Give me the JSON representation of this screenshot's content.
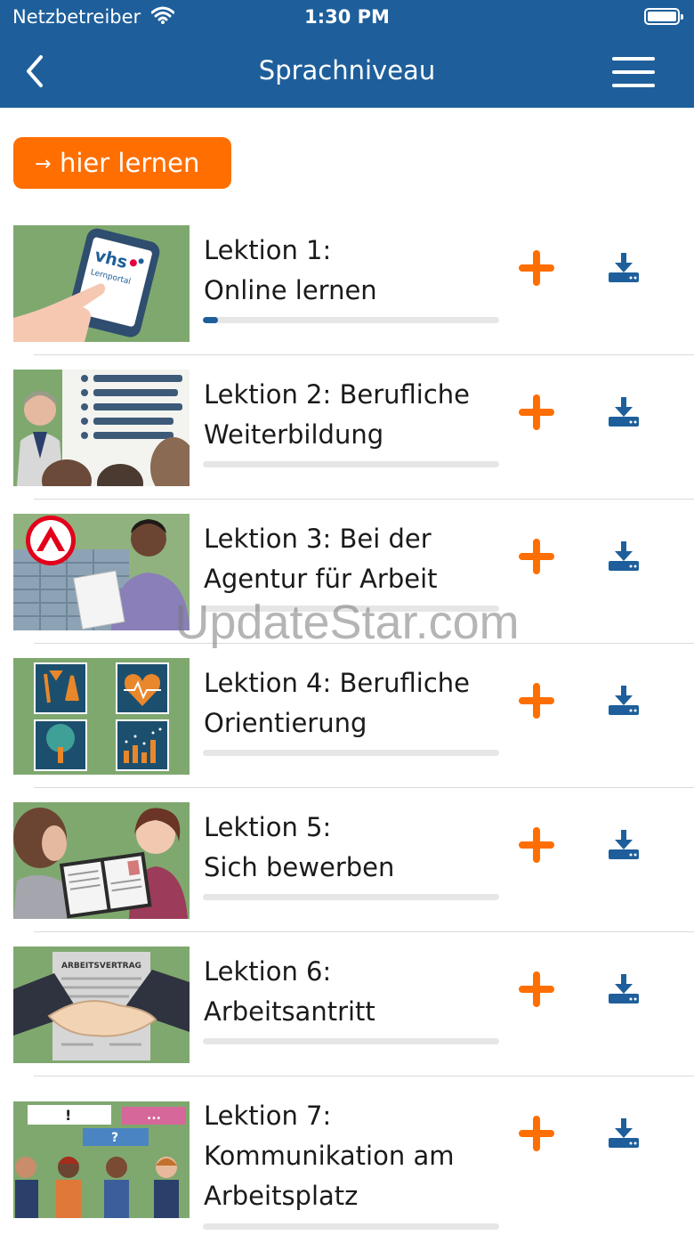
{
  "status": {
    "carrier": "Netzbetreiber",
    "time": "1:30 PM"
  },
  "nav": {
    "title": "Sprachniveau"
  },
  "learn_button": {
    "label": "hier lernen"
  },
  "colors": {
    "brand_blue": "#1e5f9b",
    "accent_orange": "#ff6e00"
  },
  "lessons": [
    {
      "lines": [
        "Lektion 1:",
        "Online lernen"
      ],
      "progress": 0.05
    },
    {
      "lines": [
        "Lektion 2: Berufliche",
        "Weiterbildung"
      ],
      "progress": 0
    },
    {
      "lines": [
        "Lektion 3: Bei der",
        "Agentur für Arbeit"
      ],
      "progress": 0
    },
    {
      "lines": [
        "Lektion 4: Berufliche",
        "Orientierung"
      ],
      "progress": 0
    },
    {
      "lines": [
        "Lektion 5:",
        "Sich bewerben"
      ],
      "progress": 0
    },
    {
      "lines": [
        "Lektion 6:",
        "Arbeitsantritt"
      ],
      "progress": 0
    },
    {
      "lines": [
        "Lektion 7:",
        "Kommunikation am",
        "Arbeitsplatz"
      ],
      "progress": 0
    }
  ],
  "thumbnails": {
    "lesson1": {
      "brand_text": "vhs",
      "brand_sub": "Lernportal"
    },
    "lesson6": {
      "doc_title": "ARBEITSVERTRAG"
    },
    "lesson7": {
      "bubbles": [
        "!",
        "?",
        "..."
      ]
    }
  },
  "watermark": "UpdateStar.com"
}
